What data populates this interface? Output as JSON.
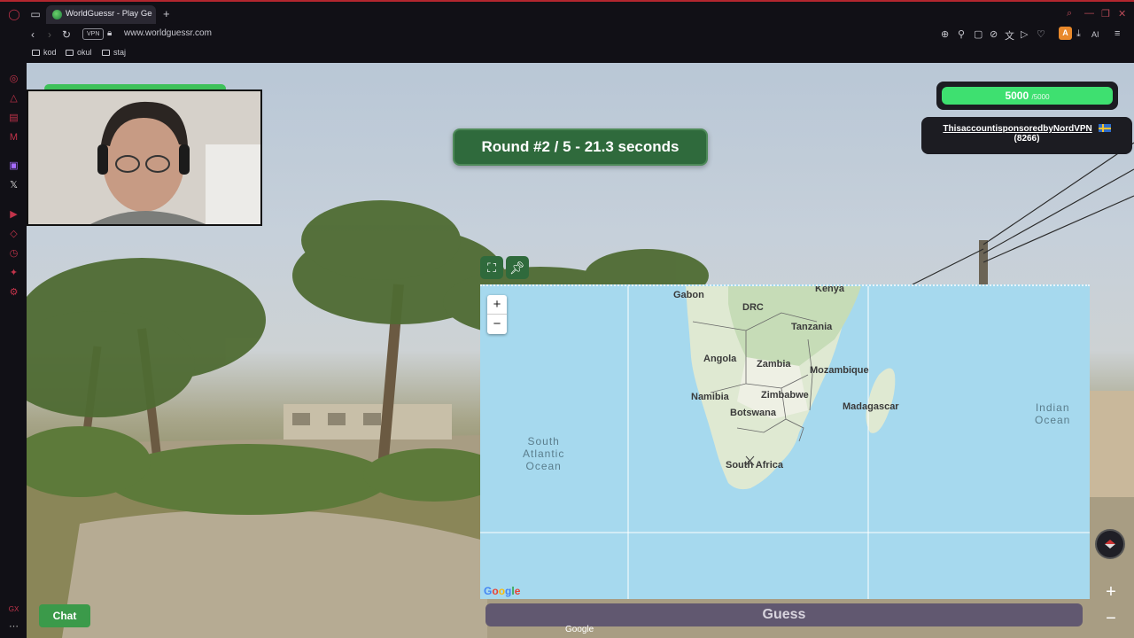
{
  "browser": {
    "tab_title": "WorldGuessr - Play Geoguessr",
    "url": "www.worldguessr.com",
    "vpn_label": "VPN",
    "extension_letter": "A",
    "ai_label": "AI",
    "bookmarks": [
      {
        "label": "kod"
      },
      {
        "label": "okul"
      },
      {
        "label": "staj"
      }
    ]
  },
  "game": {
    "round_text": "Round #2 / 5 - 21.3 seconds",
    "score": "5000",
    "score_max": "/5000",
    "score_fraction": 1.0,
    "player_name": "ThisaccountisponsoredbyNordVPN",
    "player_elo": "(8266)",
    "chat_label": "Chat",
    "guess_label": "Guess",
    "google_mark": "Google"
  },
  "map": {
    "zoom_in": "+",
    "zoom_out": "−",
    "google_logo": "Google",
    "labels": {
      "gabon": "Gabon",
      "kenya": "Kenya",
      "drc": "DRC",
      "tanzania": "Tanzania",
      "angola": "Angola",
      "zambia": "Zambia",
      "mozambique": "Mozambique",
      "namibia": "Namibia",
      "zimbabwe": "Zimbabwe",
      "botswana": "Botswana",
      "madagascar": "Madagascar",
      "south_africa": "South Africa"
    },
    "ocean_south_atlantic": [
      "South",
      "Atlantic",
      "Ocean"
    ],
    "ocean_indian": [
      "Indian",
      "Ocean"
    ]
  },
  "colors": {
    "accent_green": "#2f6a3c",
    "score_green": "#3ee070",
    "map_water": "#a6d9ee",
    "guess_button": "#615870"
  }
}
